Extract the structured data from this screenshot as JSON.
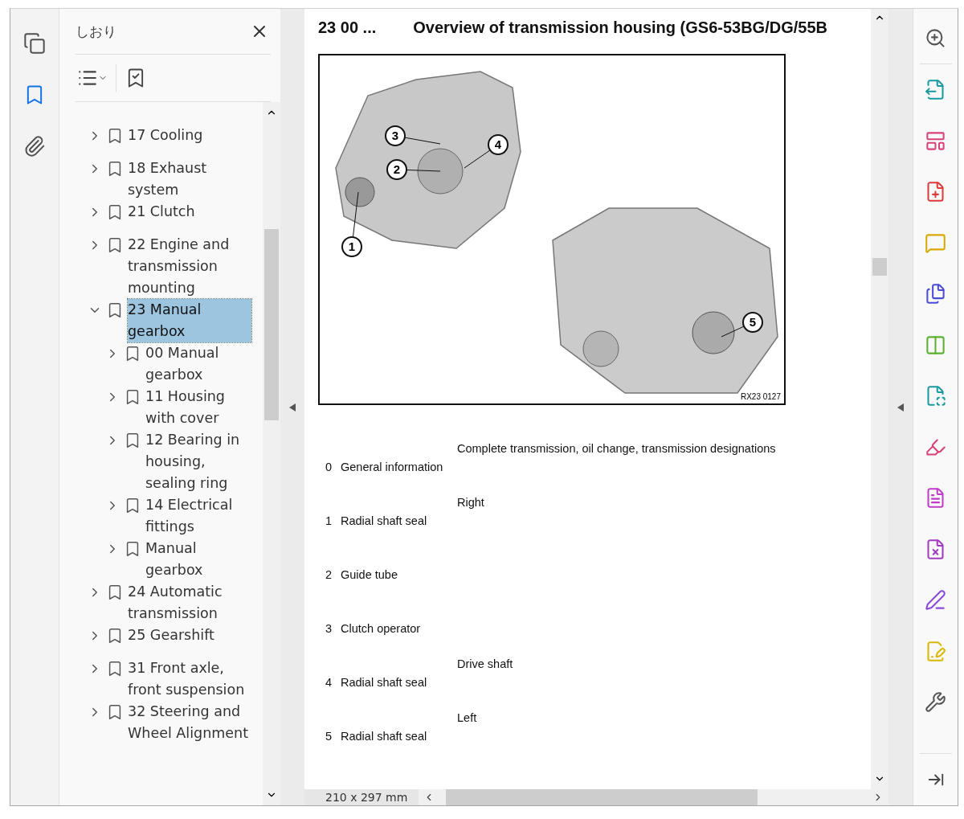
{
  "rail_tabs": [
    {
      "kind": "pages",
      "selected": false
    },
    {
      "kind": "bookmarks",
      "selected": true
    },
    {
      "kind": "attachments",
      "selected": false
    }
  ],
  "bookmarks_panel": {
    "title": "しおり",
    "items": [
      {
        "label": "17 Cooling",
        "expanded": false,
        "selected": false
      },
      {
        "label": "18 Exhaust system",
        "expanded": false,
        "selected": false
      },
      {
        "label": "21 Clutch",
        "expanded": false,
        "selected": false
      },
      {
        "label": "22 Engine and transmission mounting",
        "expanded": false,
        "selected": false
      },
      {
        "label": "23 Manual gearbox",
        "expanded": true,
        "selected": true,
        "children": [
          {
            "label": "00 Manual gearbox",
            "expanded": false,
            "selected": false
          },
          {
            "label": "11 Housing with cover",
            "expanded": false,
            "selected": false
          },
          {
            "label": "12 Bearing in housing, sealing ring",
            "expanded": false,
            "selected": false
          },
          {
            "label": "14 Electrical fittings",
            "expanded": false,
            "selected": false
          },
          {
            "label": "Manual gearbox",
            "expanded": false,
            "selected": false
          }
        ]
      },
      {
        "label": "24 Automatic transmission",
        "expanded": false,
        "selected": false
      },
      {
        "label": "25 Gearshift",
        "expanded": false,
        "selected": false
      },
      {
        "label": "31 Front axle, front suspension",
        "expanded": false,
        "selected": false
      },
      {
        "label": "32 Steering and Wheel Alignment",
        "expanded": false,
        "selected": false
      }
    ]
  },
  "document": {
    "section": "23 00 ...",
    "title": "Overview of transmission housing (GS6-53BG/DG/55B",
    "figure": {
      "callouts": [
        "1",
        "2",
        "3",
        "4",
        "5"
      ],
      "code": "RX23 0127"
    },
    "legend": [
      {
        "number": "0",
        "name": "General information",
        "note": "Complete transmission, oil change, transmission designations"
      },
      {
        "number": "1",
        "name": "Radial shaft seal",
        "note": "Right"
      },
      {
        "number": "2",
        "name": "Guide tube"
      },
      {
        "number": "3",
        "name": "Clutch operator"
      },
      {
        "number": "4",
        "name": "Radial shaft seal",
        "note": "Drive shaft"
      },
      {
        "number": "5",
        "name": "Radial shaft seal",
        "note": "Left"
      }
    ]
  },
  "status_bar": {
    "page_size": "210 x 297 mm"
  },
  "tools": [
    {
      "kind": "zoom"
    },
    {
      "kind": "export"
    },
    {
      "kind": "organize"
    },
    {
      "kind": "create"
    },
    {
      "kind": "comment"
    },
    {
      "kind": "combine"
    },
    {
      "kind": "compare"
    },
    {
      "kind": "scan"
    },
    {
      "kind": "fill"
    },
    {
      "kind": "protect"
    },
    {
      "kind": "redact"
    },
    {
      "kind": "sign"
    },
    {
      "kind": "send"
    },
    {
      "kind": "more"
    }
  ]
}
